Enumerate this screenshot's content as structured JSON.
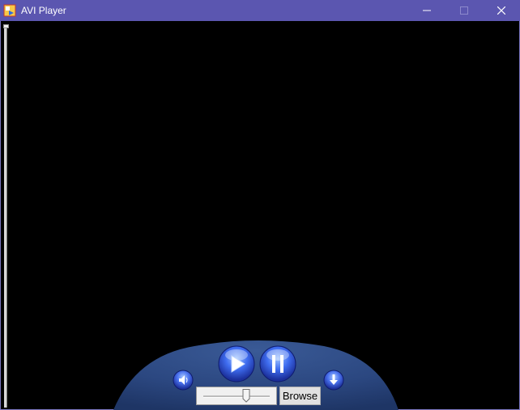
{
  "window": {
    "title": "AVI Player",
    "titlebar_color": "#5b56b0"
  },
  "controls": {
    "browse_label": "Browse",
    "play_icon": "play-icon",
    "pause_icon": "pause-icon",
    "volume_icon": "speaker-icon",
    "download_icon": "download-icon"
  },
  "colors": {
    "video_background": "#000000",
    "dome": "#2d4a84",
    "orb": "#3a64e8"
  }
}
